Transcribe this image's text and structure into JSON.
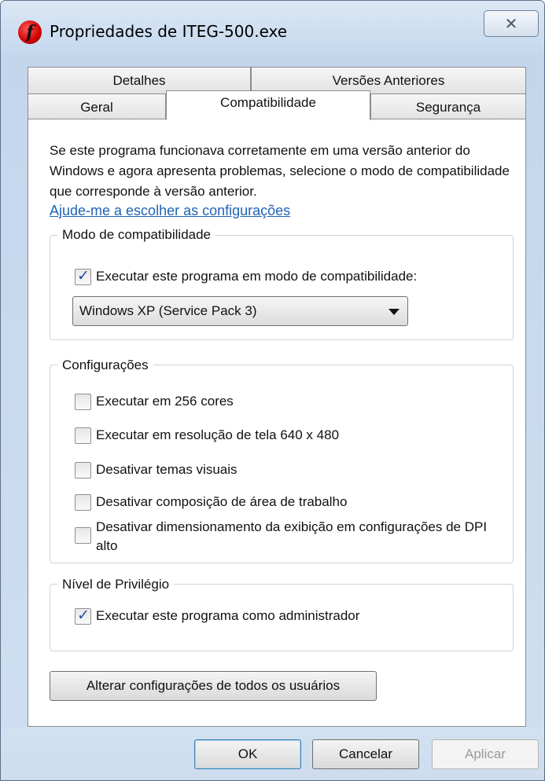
{
  "window": {
    "title": "Propriedades de ITEG-500.exe",
    "close_label": "✕"
  },
  "tabs": {
    "row1": [
      {
        "label": "Detalhes"
      },
      {
        "label": "Versões Anteriores"
      }
    ],
    "row2": [
      {
        "label": "Geral"
      },
      {
        "label": "Compatibilidade",
        "active": true
      },
      {
        "label": "Segurança"
      }
    ]
  },
  "intro": {
    "text": "Se este programa funcionava corretamente em uma versão anterior do Windows e agora apresenta problemas, selecione o modo de compatibilidade que corresponde à versão anterior.",
    "help_link": "Ajude-me a escolher as configurações"
  },
  "compat_mode": {
    "title": "Modo de compatibilidade",
    "checkbox_label": "Executar este programa em modo de compatibilidade:",
    "checked": true,
    "selected_value": "Windows XP (Service Pack 3)"
  },
  "settings": {
    "title": "Configurações",
    "items": [
      {
        "label": "Executar em 256 cores",
        "checked": false
      },
      {
        "label": "Executar em resolução de tela 640 x 480",
        "checked": false
      },
      {
        "label": "Desativar temas visuais",
        "checked": false
      },
      {
        "label": "Desativar composição de área de trabalho",
        "checked": false
      },
      {
        "label": "Desativar dimensionamento da exibição em configurações de DPI alto",
        "checked": false
      }
    ]
  },
  "privilege": {
    "title": "Nível de Privilégio",
    "checkbox_label": "Executar este programa como administrador",
    "checked": true
  },
  "all_users_button": "Alterar configurações de todos os usuários",
  "footer": {
    "ok": "OK",
    "cancel": "Cancelar",
    "apply": "Aplicar"
  }
}
